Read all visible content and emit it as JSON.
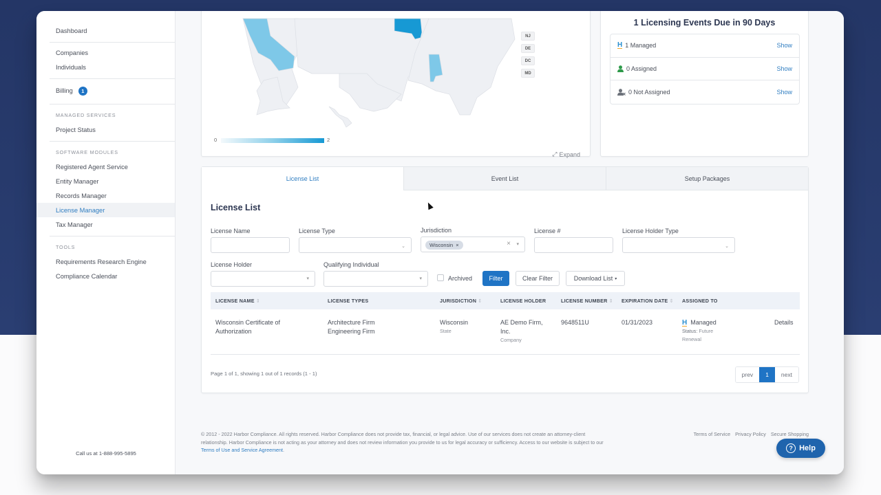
{
  "colors": {
    "accent": "#1f74c5",
    "link": "#2f7dc1",
    "background_top": "#243666",
    "map_high": "#1799d4",
    "map_mid": "#7ec8e8",
    "map_empty": "#eef0f4"
  },
  "sidebar": {
    "sections": [
      {
        "items": [
          {
            "label": "Dashboard"
          }
        ]
      },
      {
        "items": [
          {
            "label": "Companies"
          },
          {
            "label": "Individuals"
          }
        ]
      },
      {
        "items": [
          {
            "label": "Billing",
            "badge": "1"
          }
        ]
      },
      {
        "heading": "MANAGED SERVICES",
        "items": [
          {
            "label": "Project Status"
          }
        ]
      },
      {
        "heading": "SOFTWARE MODULES",
        "items": [
          {
            "label": "Registered Agent Service"
          },
          {
            "label": "Entity Manager"
          },
          {
            "label": "Records Manager"
          },
          {
            "label": "License Manager",
            "active": true
          },
          {
            "label": "Tax Manager"
          }
        ]
      },
      {
        "heading": "TOOLS",
        "items": [
          {
            "label": "Requirements Research Engine"
          },
          {
            "label": "Compliance Calendar"
          }
        ]
      }
    ],
    "phone": "Call us at 1-888-995-5895"
  },
  "map": {
    "legend_min": "0",
    "legend_max": "2",
    "small_states": [
      "NJ",
      "DE",
      "DC",
      "MD"
    ],
    "expand_label": "Expand",
    "highlighted_states": [
      {
        "state": "California",
        "value": 1
      },
      {
        "state": "Wisconsin",
        "value": 2
      },
      {
        "state": "Alabama",
        "value": 1
      }
    ]
  },
  "events": {
    "title": "1 Licensing Events Due in 90 Days",
    "rows": [
      {
        "icon": "harbor-h-icon",
        "label": "1 Managed",
        "action": "Show"
      },
      {
        "icon": "user-icon",
        "label": "0 Assigned",
        "action": "Show"
      },
      {
        "icon": "user-x-icon",
        "label": "0 Not Assigned",
        "action": "Show"
      }
    ]
  },
  "tabs": [
    {
      "label": "License List",
      "active": true
    },
    {
      "label": "Event List"
    },
    {
      "label": "Setup Packages"
    }
  ],
  "license_list": {
    "title": "License List",
    "filters": {
      "license_name": {
        "label": "License Name",
        "value": ""
      },
      "license_type": {
        "label": "License Type",
        "value": ""
      },
      "jurisdiction": {
        "label": "Jurisdiction",
        "chip": "Wisconsin"
      },
      "license_number": {
        "label": "License #",
        "value": ""
      },
      "license_holder_type": {
        "label": "License Holder Type",
        "value": ""
      },
      "license_holder": {
        "label": "License Holder",
        "value": ""
      },
      "qualifying_individual": {
        "label": "Qualifying Individual",
        "value": ""
      },
      "archived": {
        "label": "Archived",
        "checked": false
      }
    },
    "buttons": {
      "filter": "Filter",
      "clear": "Clear Filter",
      "download": "Download List"
    },
    "columns": [
      "LICENSE NAME",
      "LICENSE TYPES",
      "JURISDICTION",
      "LICENSE HOLDER",
      "LICENSE NUMBER",
      "EXPIRATION DATE",
      "ASSIGNED TO"
    ],
    "rows": [
      {
        "name_line1": "Wisconsin Certificate of",
        "name_line2": "Authorization",
        "type_line1": "Architecture Firm",
        "type_line2": "Engineering Firm",
        "jurisdiction": "Wisconsin",
        "jurisdiction_level": "State",
        "holder_line1": "AE Demo Firm,",
        "holder_line2": "Inc.",
        "holder_type": "Company",
        "number": "9648511U",
        "expiration": "01/31/2023",
        "assigned": "Managed",
        "status_label": "Status:",
        "status_line1": "Future",
        "status_line2": "Renewal",
        "action": "Details"
      }
    ],
    "pager_text": "Page 1 of 1, showing 1 out of 1 records (1 - 1)",
    "pager": {
      "prev": "prev",
      "current": "1",
      "next": "next"
    }
  },
  "footer": {
    "text": "© 2012 - 2022 Harbor Compliance. All rights reserved. Harbor Compliance does not provide tax, financial, or legal advice. Use of our services does not create an attorney-client relationship. Harbor Compliance is not acting as your attorney and does not review information you provide to us for legal accuracy or sufficiency. Access to our website is subject to our ",
    "terms_link": "Terms of Use and Service Agreement",
    "links": [
      "Terms of Service",
      "Privacy Policy",
      "Secure Shopping"
    ]
  },
  "help": {
    "label": "Help",
    "icon": "?"
  }
}
